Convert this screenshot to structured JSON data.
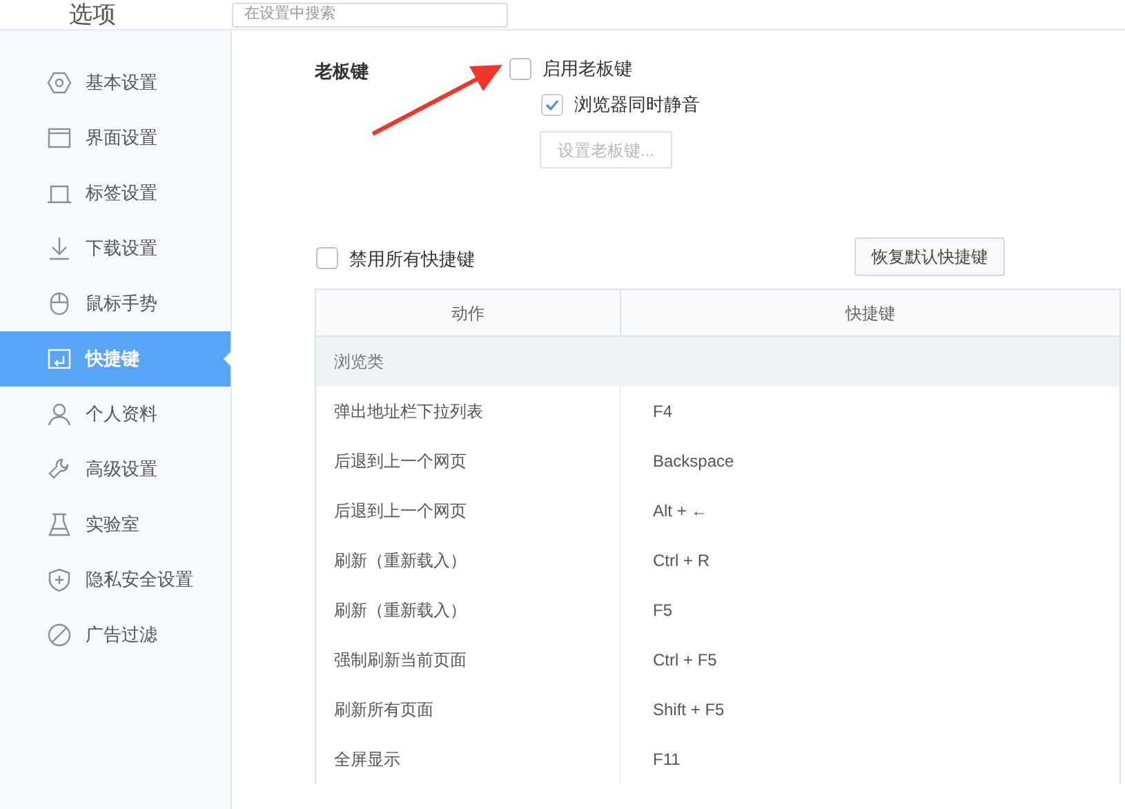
{
  "window": {
    "title": "选项"
  },
  "search": {
    "placeholder": "在设置中搜索"
  },
  "sidebar": {
    "items": [
      {
        "label": "基本设置",
        "kind": "general",
        "selected": false
      },
      {
        "label": "界面设置",
        "kind": "interface",
        "selected": false
      },
      {
        "label": "标签设置",
        "kind": "tabs",
        "selected": false
      },
      {
        "label": "下载设置",
        "kind": "downloads",
        "selected": false
      },
      {
        "label": "鼠标手势",
        "kind": "gestures",
        "selected": false
      },
      {
        "label": "快捷键",
        "kind": "shortcuts",
        "selected": true
      },
      {
        "label": "个人资料",
        "kind": "profile",
        "selected": false
      },
      {
        "label": "高级设置",
        "kind": "advanced",
        "selected": false
      },
      {
        "label": "实验室",
        "kind": "lab",
        "selected": false
      },
      {
        "label": "隐私安全设置",
        "kind": "privacy",
        "selected": false
      },
      {
        "label": "广告过滤",
        "kind": "adblock",
        "selected": false
      }
    ]
  },
  "boss_key": {
    "heading": "老板键",
    "options": [
      {
        "label": "启用老板键",
        "checked": false
      },
      {
        "label": "浏览器同时静音",
        "checked": true
      }
    ],
    "button": {
      "label": "设置老板键...",
      "disabled": true
    }
  },
  "disable_all": {
    "label": "禁用所有快捷键",
    "checked": false
  },
  "restore_button": "恢复默认快捷键",
  "table": {
    "columns": [
      "动作",
      "快捷键"
    ],
    "groups": [
      {
        "title": "浏览类",
        "rows": [
          [
            "弹出地址栏下拉列表",
            "F4"
          ],
          [
            "后退到上一个网页",
            "Backspace"
          ],
          [
            "后退到上一个网页",
            "Alt + ←"
          ],
          [
            "刷新（重新载入）",
            "Ctrl + R"
          ],
          [
            "刷新（重新载入）",
            "F5"
          ],
          [
            "强制刷新当前页面",
            "Ctrl + F5"
          ],
          [
            "刷新所有页面",
            "Shift + F5"
          ],
          [
            "全屏显示",
            "F11"
          ]
        ]
      }
    ]
  }
}
